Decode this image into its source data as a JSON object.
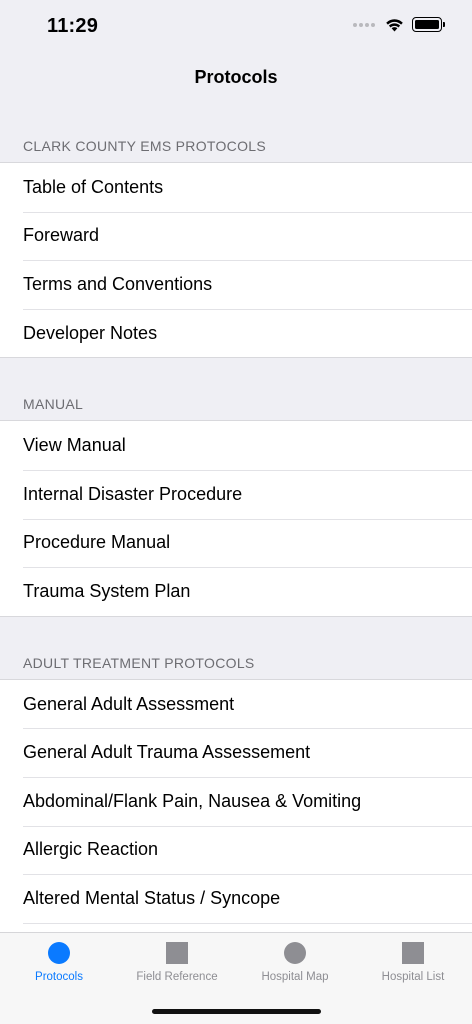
{
  "status_bar": {
    "time": "11:29"
  },
  "nav": {
    "title": "Protocols"
  },
  "sections": [
    {
      "header": "CLARK COUNTY EMS PROTOCOLS",
      "items": [
        "Table of Contents",
        "Foreward",
        "Terms and Conventions",
        "Developer Notes"
      ]
    },
    {
      "header": "MANUAL",
      "items": [
        "View Manual",
        "Internal Disaster Procedure",
        "Procedure Manual",
        "Trauma System Plan"
      ]
    },
    {
      "header": "ADULT TREATMENT PROTOCOLS",
      "items": [
        "General Adult Assessment",
        "General Adult Trauma Assessement",
        "Abdominal/Flank Pain, Nausea & Vomiting",
        "Allergic Reaction",
        "Altered Mental Status / Syncope"
      ]
    }
  ],
  "tabs": [
    {
      "label": "Protocols",
      "icon": "circle-icon",
      "active": true
    },
    {
      "label": "Field Reference",
      "icon": "square-icon",
      "active": false
    },
    {
      "label": "Hospital Map",
      "icon": "circle-icon",
      "active": false
    },
    {
      "label": "Hospital List",
      "icon": "square-icon",
      "active": false
    }
  ],
  "colors": {
    "accent": "#0a7aff",
    "inactive_icon": "#8e8e93",
    "background": "#efeff4"
  }
}
